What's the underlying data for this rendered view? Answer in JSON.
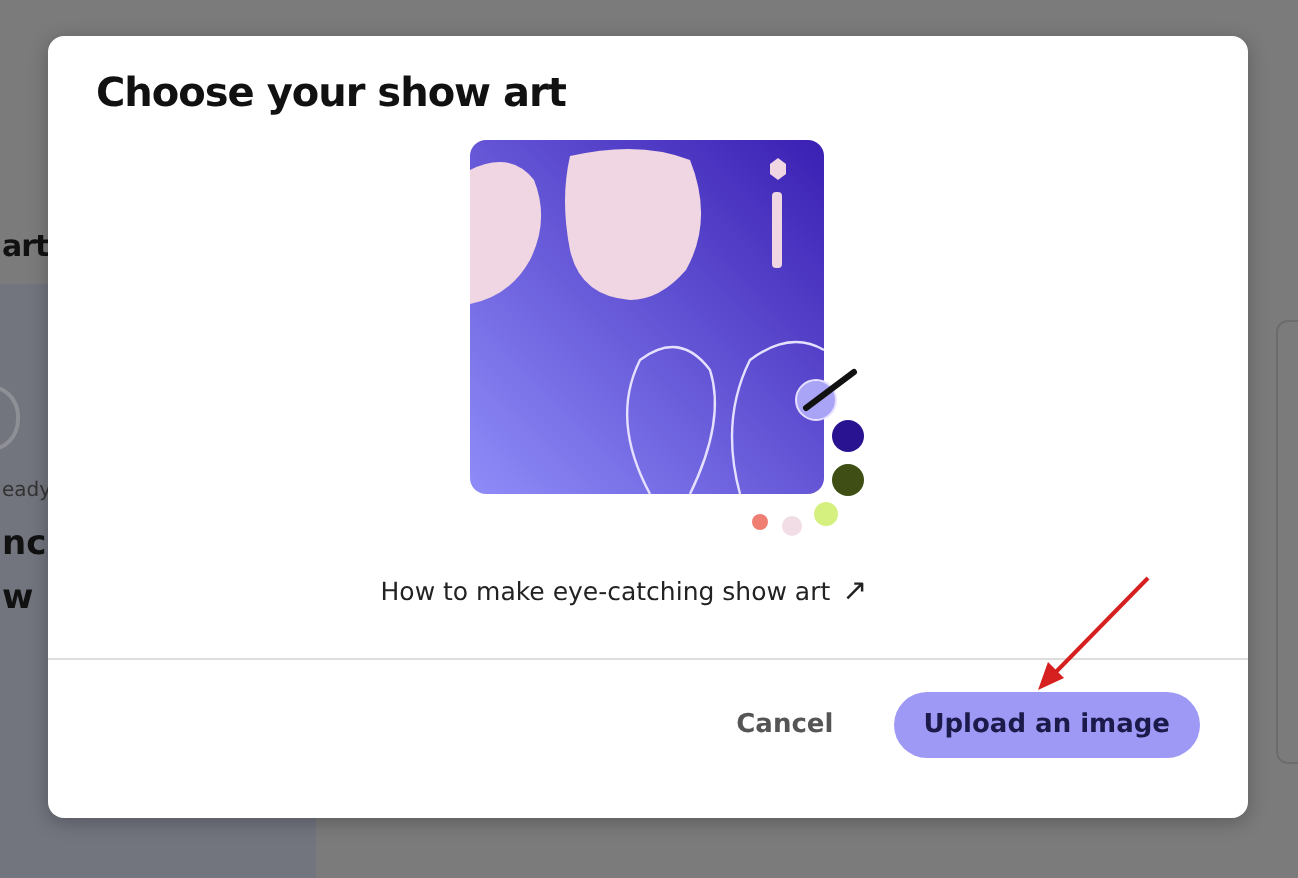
{
  "background": {
    "heading": "art",
    "caption": "eady",
    "title_lines": [
      "nc",
      "w"
    ]
  },
  "dialog": {
    "title": "Choose your show art",
    "link": {
      "label": "How to make eye-catching show art",
      "icon": "↗"
    },
    "buttons": [
      {
        "label": "Cancel",
        "kind": "text"
      },
      {
        "label": "Upload an image",
        "kind": "primary"
      }
    ]
  },
  "annotation": {
    "kind": "arrow"
  }
}
